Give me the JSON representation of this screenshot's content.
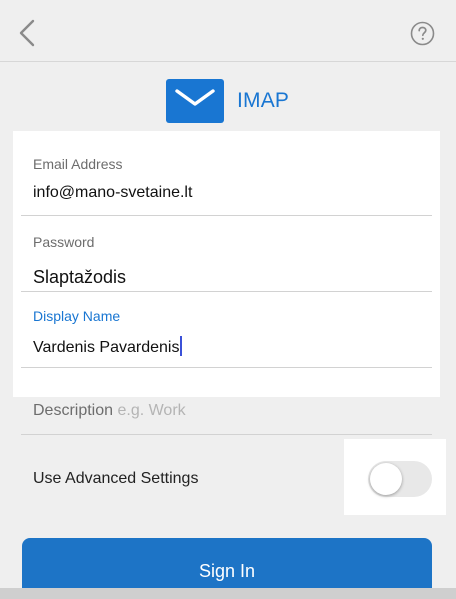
{
  "header": {
    "back_icon": "chevron-left-icon",
    "help_icon": "question-circle-icon"
  },
  "brand": {
    "icon": "envelope-icon",
    "title": "IMAP",
    "accent_color": "#1976d2"
  },
  "form": {
    "email": {
      "label": "Email Address",
      "value": "info@mano-svetaine.lt"
    },
    "password": {
      "label": "Password",
      "value": "Slaptažodis"
    },
    "display_name": {
      "label": "Display Name",
      "value": "Vardenis Pavardenis",
      "label_color": "#1976d2"
    },
    "description": {
      "label": "Description",
      "placeholder": "e.g. Work",
      "value": ""
    },
    "advanced": {
      "label": "Use Advanced Settings",
      "enabled": false
    }
  },
  "actions": {
    "sign_in_label": "Sign In",
    "sign_in_color": "#1d74c6"
  }
}
